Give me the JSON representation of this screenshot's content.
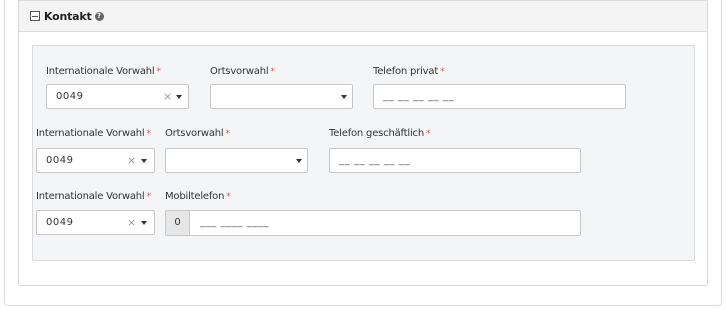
{
  "section": {
    "title": "Kontakt",
    "collapse_icon": "minus-square-icon",
    "help_icon": "question-circle-icon",
    "help_glyph": "?"
  },
  "required_marker": "*",
  "row1": {
    "country_code_label": "Internationale Vorwahl",
    "country_code_value": "0049",
    "area_code_label": "Ortsvorwahl",
    "area_code_value": "",
    "phone_label": "Telefon privat",
    "phone_placeholder": "__ __ __ __ __"
  },
  "row2": {
    "country_code_label": "Internationale Vorwahl",
    "country_code_value": "0049",
    "area_code_label": "Ortsvorwahl",
    "area_code_value": "",
    "phone_label": "Telefon geschäftlich",
    "phone_placeholder": "__ __ __ __ __"
  },
  "row3": {
    "country_code_label": "Internationale Vorwahl",
    "country_code_value": "0049",
    "mobile_label": "Mobiltelefon",
    "mobile_prefix": "0",
    "mobile_placeholder": "___ ____ ____"
  },
  "icons": {
    "clear": "×",
    "dropdown": "caret-down-icon"
  }
}
